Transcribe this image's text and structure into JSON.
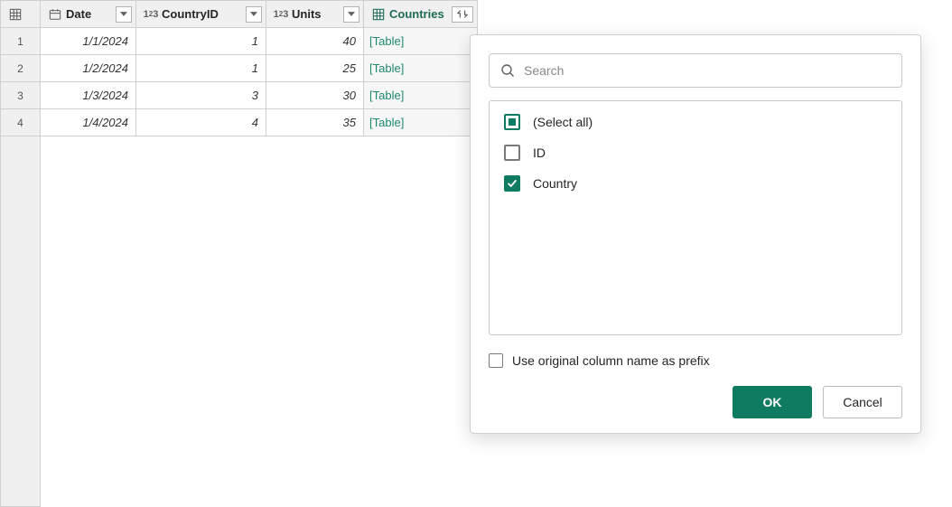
{
  "columns": {
    "date": {
      "label": "Date"
    },
    "countryId": {
      "label": "CountryID"
    },
    "units": {
      "label": "Units"
    },
    "countries": {
      "label": "Countries"
    }
  },
  "rows": [
    {
      "n": "1",
      "date": "1/1/2024",
      "cid": "1",
      "units": "40",
      "countries": "[Table]"
    },
    {
      "n": "2",
      "date": "1/2/2024",
      "cid": "1",
      "units": "25",
      "countries": "[Table]"
    },
    {
      "n": "3",
      "date": "1/3/2024",
      "cid": "3",
      "units": "30",
      "countries": "[Table]"
    },
    {
      "n": "4",
      "date": "1/4/2024",
      "cid": "4",
      "units": "35",
      "countries": "[Table]"
    }
  ],
  "popup": {
    "search_placeholder": "Search",
    "select_all": "(Select all)",
    "option_id": "ID",
    "option_country": "Country",
    "prefix_label": "Use original column name as prefix",
    "ok": "OK",
    "cancel": "Cancel"
  }
}
